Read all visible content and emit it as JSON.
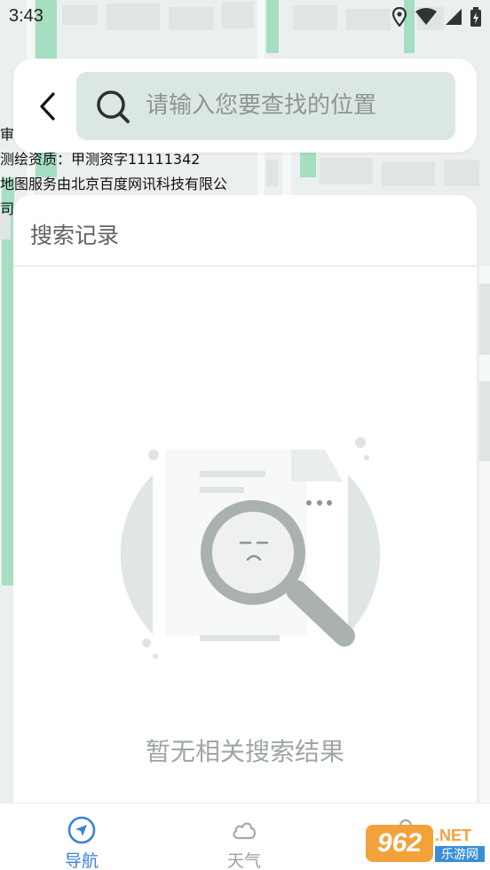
{
  "status_bar": {
    "time": "3:43"
  },
  "search": {
    "placeholder": "请输入您要查找的位置"
  },
  "map_attribution": {
    "line1": "审",
    "line2": "测绘资质：甲测资字11111342",
    "line3": "地图服务由北京百度网讯科技有限公",
    "line4": "司"
  },
  "history": {
    "title": "搜索记录",
    "empty_text": "暂无相关搜索结果"
  },
  "bottom_nav": {
    "items": [
      {
        "label": "导航",
        "icon": "navigation-arrow-icon",
        "active": true
      },
      {
        "label": "天气",
        "icon": "cloud-icon",
        "active": false
      },
      {
        "label": "",
        "icon": "profile-icon",
        "active": false
      }
    ]
  },
  "watermark": {
    "text1": "962",
    "text2": ".NET",
    "text3": "乐游网"
  },
  "colors": {
    "accent": "#3e7fd9",
    "search_box_bg": "#dbe7e3",
    "map_bg": "#eef0f1",
    "map_road_green": "#8fd6b0"
  }
}
